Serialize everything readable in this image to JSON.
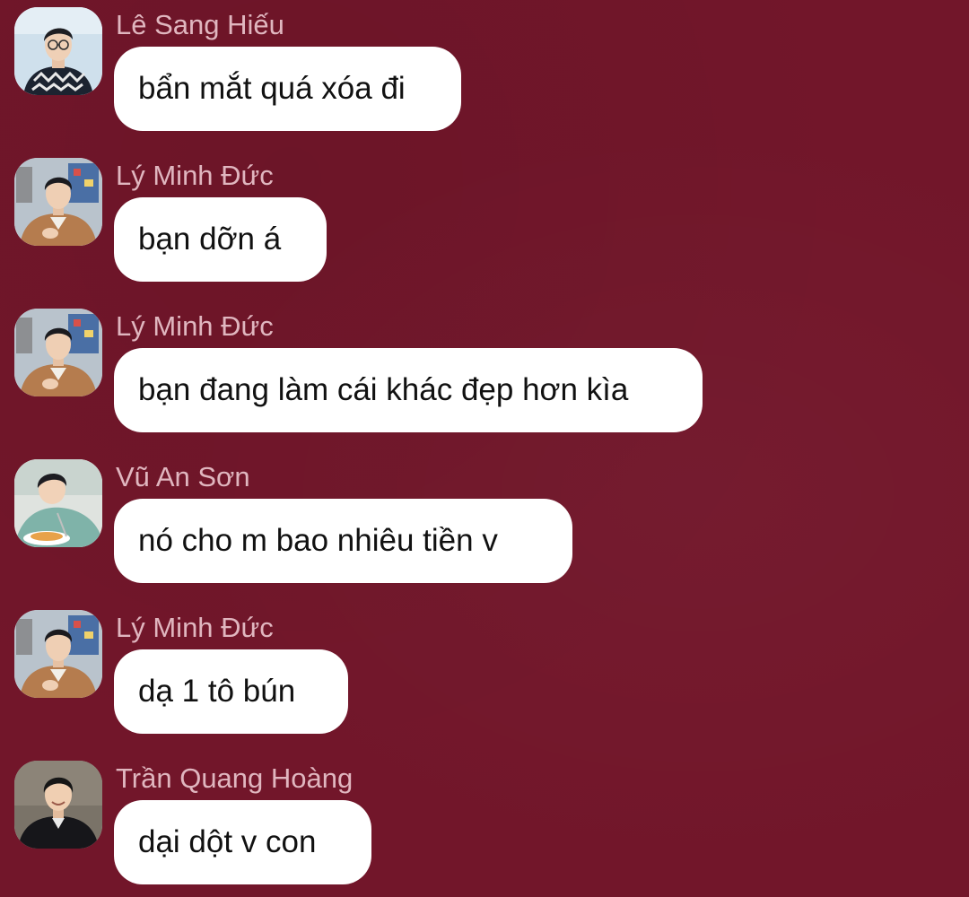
{
  "conversation": {
    "messages": [
      {
        "sender": "Lê Sang Hiếu",
        "text": "bẩn mắt quá xóa đi",
        "avatar_icon": "avatar-le-sang-hieu-icon"
      },
      {
        "sender": "Lý Minh Đức",
        "text": "bạn dỡn á",
        "avatar_icon": "avatar-ly-minh-duc-icon"
      },
      {
        "sender": "Lý Minh Đức",
        "text": "bạn đang làm cái khác đẹp hơn kìa",
        "avatar_icon": "avatar-ly-minh-duc-icon"
      },
      {
        "sender": "Vũ An Sơn",
        "text": "nó cho m bao nhiêu tiền v",
        "avatar_icon": "avatar-vu-an-son-icon"
      },
      {
        "sender": "Lý Minh Đức",
        "text": "dạ 1 tô bún",
        "avatar_icon": "avatar-ly-minh-duc-icon"
      },
      {
        "sender": "Trần Quang Hoàng",
        "text": "dại dột v con",
        "avatar_icon": "avatar-tran-quang-hoang-icon"
      }
    ]
  },
  "colors": {
    "background": "#72162a",
    "sender_name": "#e0b6bf",
    "bubble": "#ffffff",
    "bubble_text": "#111111"
  }
}
